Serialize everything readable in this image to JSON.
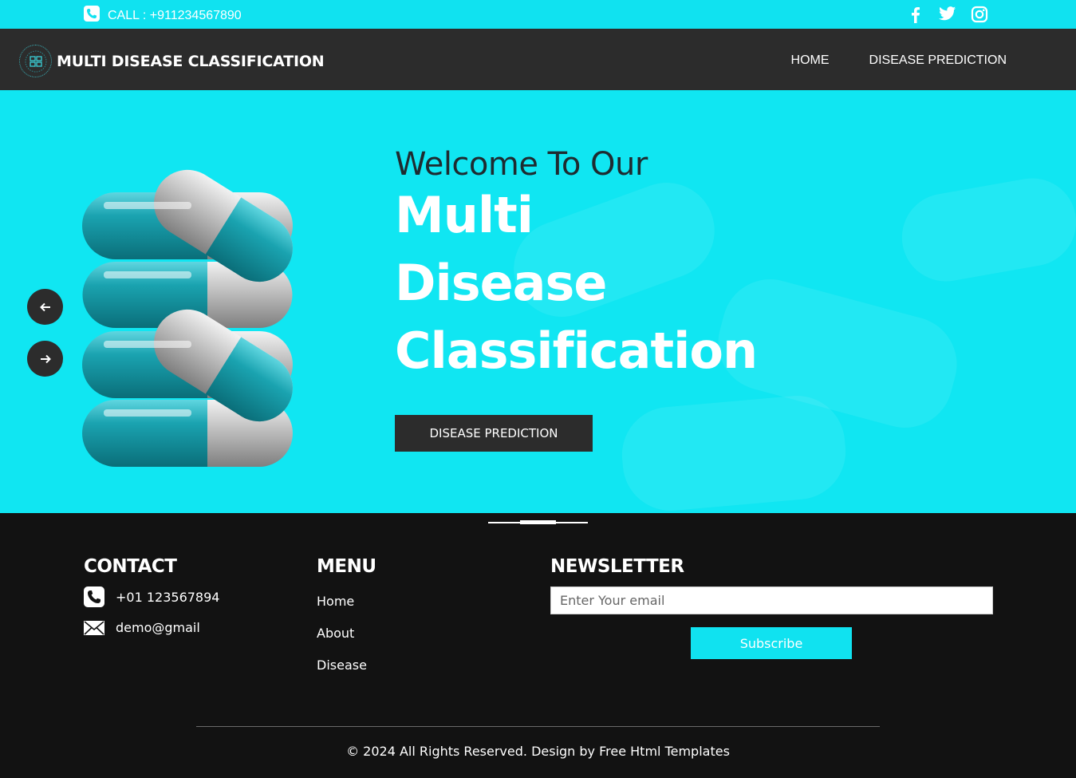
{
  "topbar": {
    "call_text": "CALL : +911234567890",
    "social": [
      "facebook-icon",
      "twitter-icon",
      "instagram-icon"
    ]
  },
  "navbar": {
    "brand": "MULTI DISEASE CLASSIFICATION",
    "links": [
      "HOME",
      "DISEASE PREDICTION"
    ]
  },
  "hero": {
    "welcome": "Welcome To Our",
    "title_lines": [
      "Multi",
      "Disease",
      "Classification"
    ],
    "cta": "DISEASE PREDICTION"
  },
  "footer": {
    "contact": {
      "heading": "CONTACT",
      "phone": "+01 123567894",
      "email": "demo@gmail"
    },
    "menu": {
      "heading": "MENU",
      "items": [
        "Home",
        "About",
        "Disease"
      ]
    },
    "newsletter": {
      "heading": "NEWSLETTER",
      "placeholder": "Enter Your email",
      "button": "Subscribe"
    },
    "copyright": "© 2024 All Rights Reserved. Design by Free Html Templates"
  },
  "colors": {
    "accent": "#10e2f0",
    "dark": "#2c2c2c",
    "footer_bg": "#121212"
  }
}
